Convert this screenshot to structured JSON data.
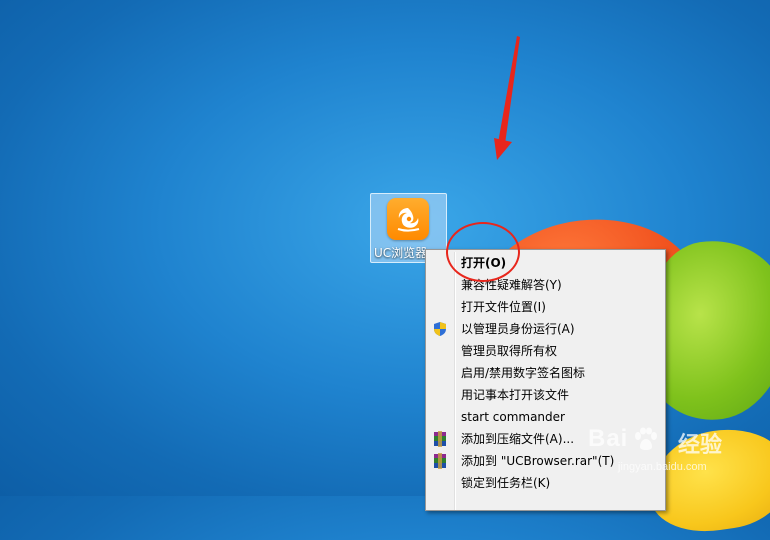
{
  "desktop": {
    "icon": {
      "label": "UC浏览器",
      "icon_name": "uc-browser-icon"
    }
  },
  "context_menu": {
    "items": [
      {
        "label": "打开(O)",
        "bold": true,
        "icon": null
      },
      {
        "label": "兼容性疑难解答(Y)",
        "bold": false,
        "icon": null
      },
      {
        "label": "打开文件位置(I)",
        "bold": false,
        "icon": null
      },
      {
        "label": "以管理员身份运行(A)",
        "bold": false,
        "icon": "uac-shield-icon"
      },
      {
        "label": "管理员取得所有权",
        "bold": false,
        "icon": null
      },
      {
        "label": "启用/禁用数字签名图标",
        "bold": false,
        "icon": null
      },
      {
        "label": "用记事本打开该文件",
        "bold": false,
        "icon": null
      },
      {
        "label": "start commander",
        "bold": false,
        "icon": null
      },
      {
        "label": "添加到压缩文件(A)...",
        "bold": false,
        "icon": "winrar-icon"
      },
      {
        "label": "添加到 \"UCBrowser.rar\"(T)",
        "bold": false,
        "icon": "winrar-icon"
      },
      {
        "label": "锁定到任务栏(K)",
        "bold": false,
        "icon": null
      }
    ]
  },
  "watermark": {
    "brand": "Bai",
    "suffix": "经验",
    "url": "jingyan.baidu.com"
  },
  "colors": {
    "annotation_red": "#e8261c",
    "menu_bg": "#f0f0f0",
    "uc_orange": "#ff8a00"
  }
}
